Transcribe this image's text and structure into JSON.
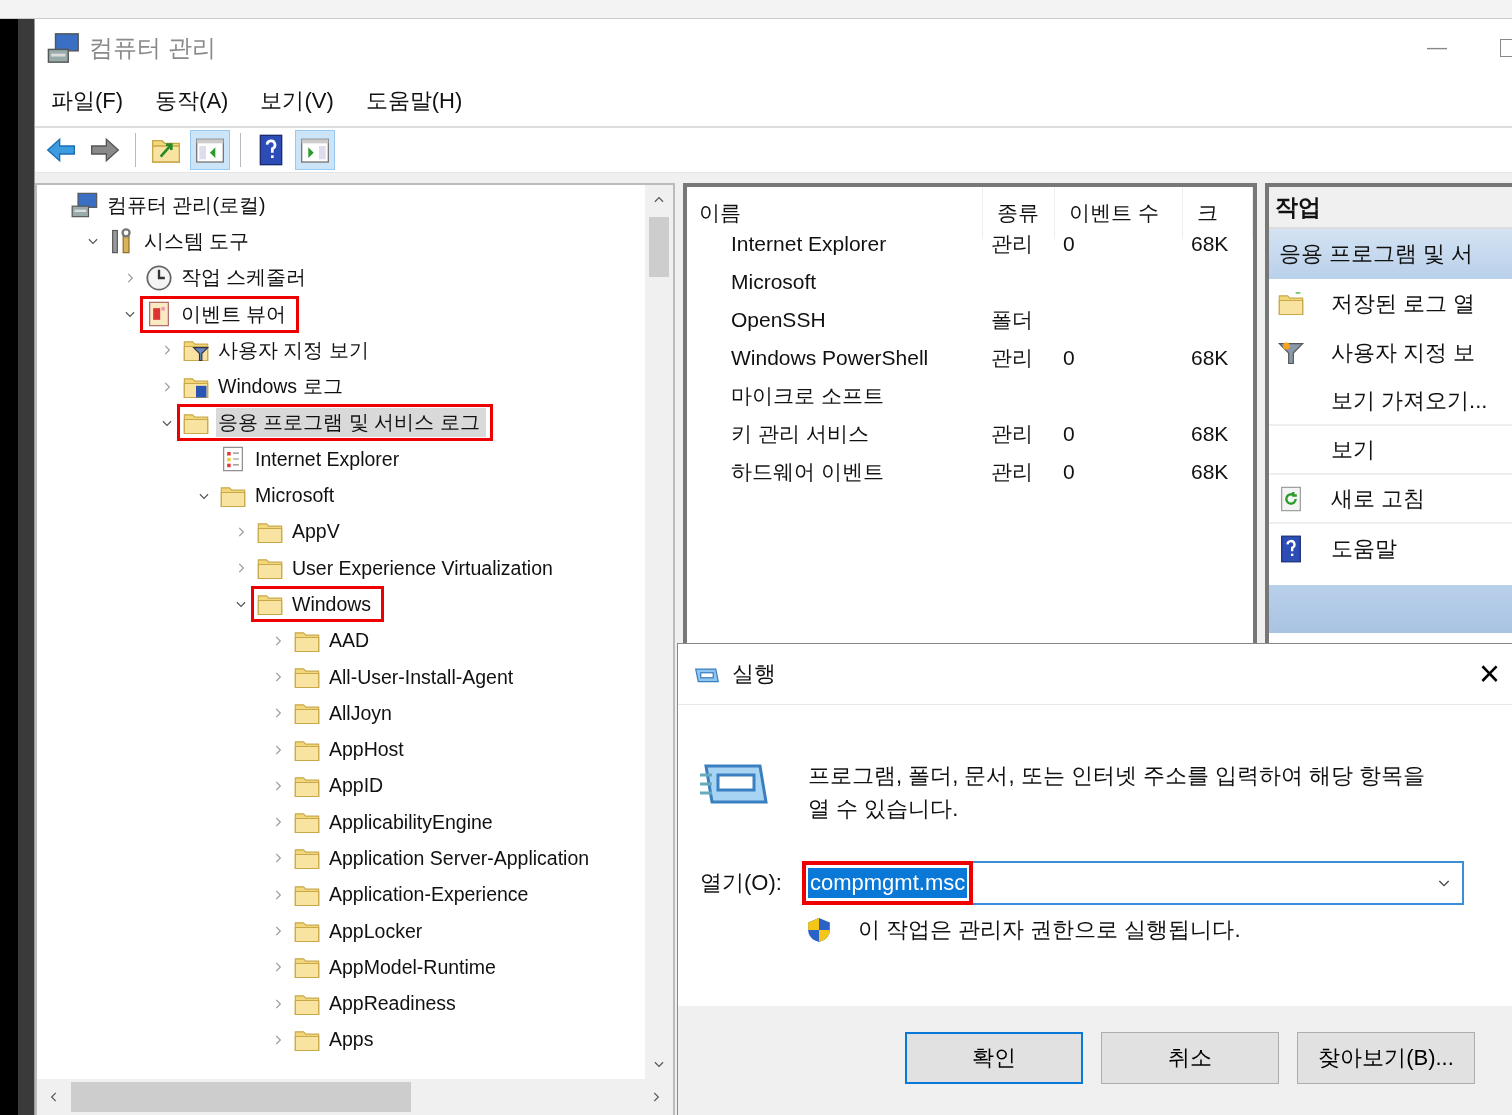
{
  "window": {
    "title": "컴퓨터 관리",
    "minimize": "—"
  },
  "menu": [
    {
      "label": "파일(F)"
    },
    {
      "label": "동작(A)"
    },
    {
      "label": "보기(V)"
    },
    {
      "label": "도움말(H)"
    }
  ],
  "toolbar": [
    {
      "kind": "back",
      "pressed": false
    },
    {
      "kind": "forward",
      "pressed": false
    },
    {
      "kind": "separator"
    },
    {
      "kind": "up",
      "pressed": false
    },
    {
      "kind": "tree-toggle",
      "pressed": true
    },
    {
      "kind": "separator"
    },
    {
      "kind": "help",
      "pressed": false
    },
    {
      "kind": "pane-toggle",
      "pressed": true
    }
  ],
  "tree": [
    {
      "label": "컴퓨터 관리(로컬)",
      "kind": "computer",
      "selected": false,
      "annotated": false,
      "children": [
        {
          "label": "시스템 도구",
          "kind": "tools",
          "expanded": true,
          "selected": false,
          "annotated": false,
          "children": [
            {
              "label": "작업 스케줄러",
              "kind": "clock",
              "expanded": false,
              "selected": false,
              "annotated": false
            },
            {
              "label": "이벤트 뷰어",
              "kind": "viewer",
              "expanded": true,
              "selected": false,
              "annotated": true,
              "children": [
                {
                  "label": "사용자 지정 보기",
                  "kind": "filter-folder",
                  "expanded": false,
                  "selected": false,
                  "annotated": false
                },
                {
                  "label": "Windows 로그",
                  "kind": "log-folder",
                  "expanded": false,
                  "selected": false,
                  "annotated": false
                },
                {
                  "label": "응용 프로그램 및 서비스 로그",
                  "kind": "folder",
                  "expanded": true,
                  "selected": true,
                  "annotated": true,
                  "children": [
                    {
                      "label": "Internet Explorer",
                      "kind": "log",
                      "selected": false,
                      "annotated": false
                    },
                    {
                      "label": "Microsoft",
                      "kind": "folder",
                      "expanded": true,
                      "selected": false,
                      "annotated": false,
                      "children": [
                        {
                          "label": "AppV",
                          "kind": "folder",
                          "expanded": false,
                          "selected": false,
                          "annotated": false
                        },
                        {
                          "label": "User Experience Virtualization",
                          "kind": "folder",
                          "expanded": false,
                          "selected": false,
                          "annotated": false
                        },
                        {
                          "label": "Windows",
                          "kind": "folder",
                          "expanded": true,
                          "selected": false,
                          "annotated": true,
                          "children": [
                            {
                              "label": "AAD",
                              "kind": "folder",
                              "expanded": false,
                              "selected": false,
                              "annotated": false
                            },
                            {
                              "label": "All-User-Install-Agent",
                              "kind": "folder",
                              "expanded": false,
                              "selected": false,
                              "annotated": false
                            },
                            {
                              "label": "AllJoyn",
                              "kind": "folder",
                              "expanded": false,
                              "selected": false,
                              "annotated": false
                            },
                            {
                              "label": "AppHost",
                              "kind": "folder",
                              "expanded": false,
                              "selected": false,
                              "annotated": false
                            },
                            {
                              "label": "AppID",
                              "kind": "folder",
                              "expanded": false,
                              "selected": false,
                              "annotated": false
                            },
                            {
                              "label": "ApplicabilityEngine",
                              "kind": "folder",
                              "expanded": false,
                              "selected": false,
                              "annotated": false
                            },
                            {
                              "label": "Application Server-Application",
                              "kind": "folder",
                              "expanded": false,
                              "selected": false,
                              "annotated": false
                            },
                            {
                              "label": "Application-Experience",
                              "kind": "folder",
                              "expanded": false,
                              "selected": false,
                              "annotated": false
                            },
                            {
                              "label": "AppLocker",
                              "kind": "folder",
                              "expanded": false,
                              "selected": false,
                              "annotated": false
                            },
                            {
                              "label": "AppModel-Runtime",
                              "kind": "folder",
                              "expanded": false,
                              "selected": false,
                              "annotated": false
                            },
                            {
                              "label": "AppReadiness",
                              "kind": "folder",
                              "expanded": false,
                              "selected": false,
                              "annotated": false
                            },
                            {
                              "label": "Apps",
                              "kind": "folder",
                              "expanded": false,
                              "selected": false,
                              "annotated": false
                            }
                          ]
                        }
                      ]
                    }
                  ]
                }
              ]
            }
          ]
        }
      ]
    }
  ],
  "table": {
    "columns": [
      "이름",
      "종류",
      "이벤트 수",
      "크"
    ],
    "rows": [
      {
        "name": "Internet Explorer",
        "type": "관리",
        "count": "0",
        "size": "68K"
      },
      {
        "name": "Microsoft"
      },
      {
        "name": "OpenSSH",
        "type": "폴더"
      },
      {
        "name": "Windows PowerShell",
        "type": "관리",
        "count": "0",
        "size": "68K"
      },
      {
        "name": "마이크로 소프트"
      },
      {
        "name": "키 관리 서비스",
        "type": "관리",
        "count": "0",
        "size": "68K"
      },
      {
        "name": "하드웨어 이벤트",
        "type": "관리",
        "count": "0",
        "size": "68K"
      }
    ]
  },
  "actions": {
    "title": "작업",
    "section": "응용 프로그램 및 서",
    "items": [
      {
        "label": "저장된 로그 열",
        "kind": "open",
        "divider": false
      },
      {
        "label": "사용자 지정 보",
        "kind": "filter",
        "divider": false
      },
      {
        "label": "보기 가져오기...",
        "kind": "plain",
        "divider": true
      },
      {
        "label": "보기",
        "kind": "plain",
        "divider": true
      },
      {
        "label": "새로 고침",
        "kind": "refresh",
        "divider": true
      },
      {
        "label": "도움말",
        "kind": "help",
        "divider": false
      }
    ]
  },
  "run_dialog": {
    "title": "실행",
    "close": "×",
    "description": "프로그램, 폴더, 문서, 또는 인터넷 주소를 입력하여 해당 항목을 열 수 있습니다.",
    "open_label": "열기(O):",
    "value": "compmgmt.msc",
    "value_selected": true,
    "value_annotated": true,
    "admin_note": "이 작업은 관리자 권한으로 실행됩니다.",
    "buttons": [
      {
        "label": "확인",
        "default": true
      },
      {
        "label": "취소",
        "default": false
      },
      {
        "label": "찾아보기(B)...",
        "default": false
      }
    ]
  }
}
